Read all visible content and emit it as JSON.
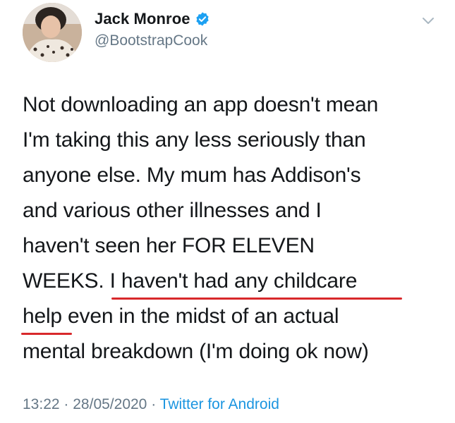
{
  "author": {
    "display_name": "Jack Monroe",
    "handle": "@BootstrapCook",
    "verified": true
  },
  "tweet": {
    "lines": [
      "Not downloading an app doesn't mean",
      "I'm taking this any less seriously than",
      "anyone else. My mum has Addison's",
      "and various other illnesses and I",
      "haven't seen her FOR ELEVEN",
      "WEEKS. I haven't had any childcare",
      "help even in the midst of an actual",
      "mental breakdown (I'm doing ok now)"
    ]
  },
  "meta": {
    "time": "13:22",
    "separator": "·",
    "date": "28/05/2020",
    "source": "Twitter for Android"
  },
  "colors": {
    "text": "#14171a",
    "secondary": "#657786",
    "link": "#1b95e0",
    "verified": "#1da1f2",
    "annotation_underline": "#d8282b"
  },
  "icons": [
    "avatar",
    "verified-badge-icon",
    "chevron-down-icon"
  ]
}
